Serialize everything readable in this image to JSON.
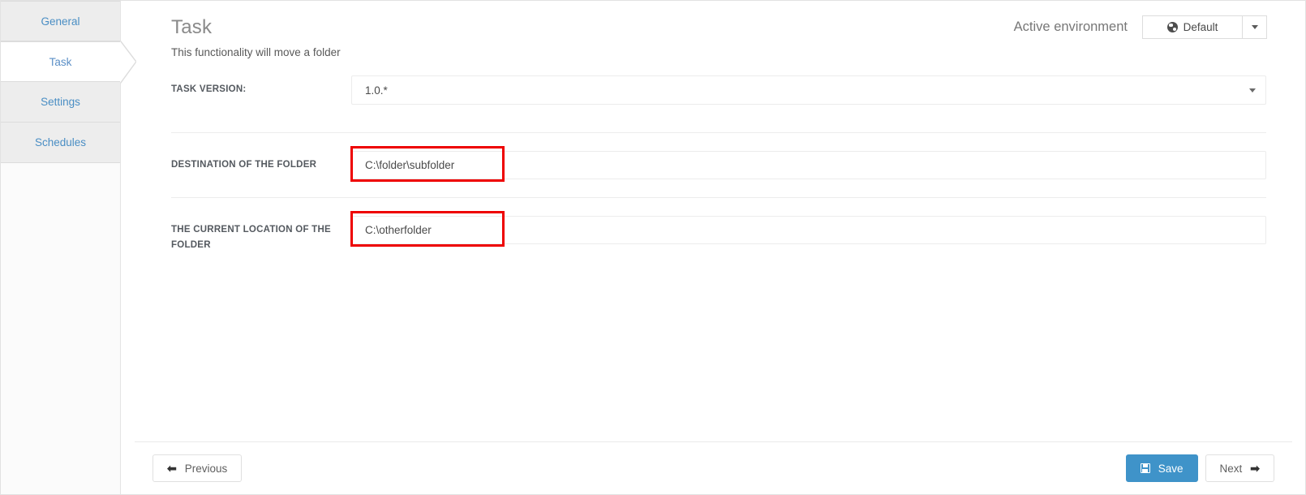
{
  "sidebar": {
    "items": [
      {
        "label": "General",
        "active": false
      },
      {
        "label": "Task",
        "active": true
      },
      {
        "label": "Settings",
        "active": false
      },
      {
        "label": "Schedules",
        "active": false
      }
    ]
  },
  "header": {
    "title": "Task",
    "subtitle": "This functionality will move a folder",
    "environment_label": "Active environment",
    "environment_value": "Default",
    "environment_icon": "globe-icon",
    "environment_caret_icon": "caret-down-icon"
  },
  "form": {
    "rows": [
      {
        "label": "TASK VERSION:",
        "value": "1.0.*",
        "placeholder": "",
        "type": "select",
        "annotated": false
      },
      {
        "label": "DESTINATION OF THE FOLDER",
        "value": "C:\\folder\\subfolder",
        "placeholder": "",
        "type": "text",
        "annotated": true
      },
      {
        "label": "THE CURRENT LOCATION OF THE FOLDER",
        "value": "C:\\otherfolder",
        "placeholder": "",
        "type": "text",
        "annotated": true
      }
    ]
  },
  "footer": {
    "previous_label": "Previous",
    "previous_icon": "arrow-left-icon",
    "save_label": "Save",
    "save_icon": "floppy-disk-icon",
    "next_label": "Next",
    "next_icon": "arrow-right-icon"
  },
  "colors": {
    "primary": "#3f93c9",
    "tab_text": "#4a8ec4",
    "annotation": "#ee0000",
    "tab_inactive_bg": "#ededed"
  }
}
